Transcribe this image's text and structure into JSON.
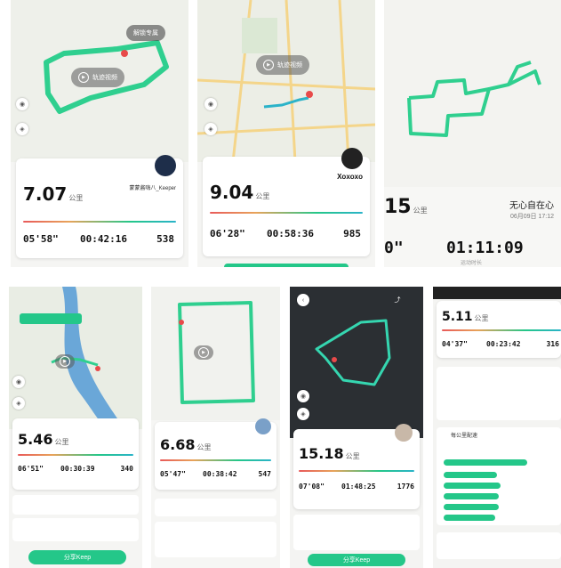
{
  "accent": "#24c789",
  "route_color": "#2fcf8f",
  "panels": [
    {
      "play_label": "轨迹视频",
      "top_badge": "解锁专属",
      "distance": "7.07",
      "unit": "公里",
      "user": "蒙蒙酱嗨八_Keeper",
      "stats": [
        "05'58\"",
        "00:42:16",
        "538"
      ]
    },
    {
      "play_label": "轨迹视频",
      "distance": "9.04",
      "unit": "公里",
      "user": "Xoxoxo",
      "stats": [
        "06'28\"",
        "00:58:36",
        "985"
      ]
    },
    {
      "distance": "15",
      "unit": "公里",
      "user": "无心自在心",
      "date": "06月09日 17:12",
      "pace": "0\"",
      "duration": "01:11:09",
      "duration_label": "运动时长"
    },
    {
      "distance": "5.46",
      "unit": "公里",
      "stats": [
        "06'51\"",
        "00:30:39",
        "340"
      ],
      "button": "分享Keep"
    },
    {
      "distance": "6.68",
      "unit": "公里",
      "stats": [
        "05'47\"",
        "00:38:42",
        "547"
      ]
    },
    {
      "distance": "15.18",
      "unit": "公里",
      "stats": [
        "07'08\"",
        "01:48:25",
        "1776"
      ],
      "button": "分享Keep"
    },
    {
      "distance": "5.11",
      "unit": "公里",
      "stats": [
        "04'37\"",
        "00:23:42",
        "316"
      ],
      "section": "每公里配速"
    }
  ]
}
